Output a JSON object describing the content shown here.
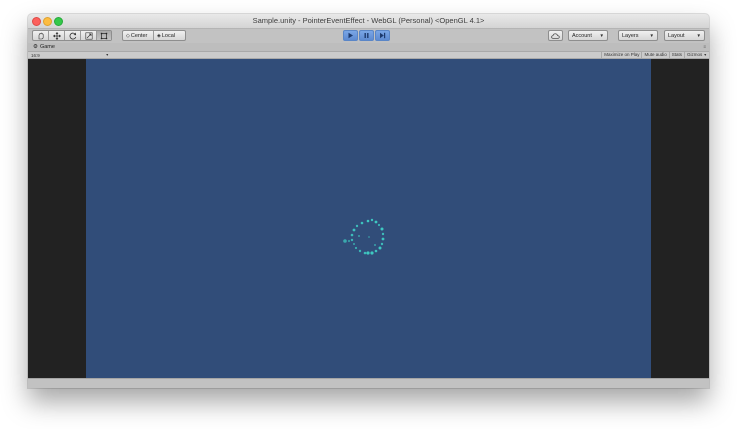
{
  "window": {
    "title": "Sample.unity - PointerEventEffect - WebGL (Personal) <OpenGL 4.1>"
  },
  "toolbar": {
    "tools": [
      {
        "icon": "hand-icon",
        "active": false
      },
      {
        "icon": "move-icon",
        "active": false
      },
      {
        "icon": "rotate-icon",
        "active": false
      },
      {
        "icon": "scale-icon",
        "active": false
      },
      {
        "icon": "rect-icon",
        "active": true
      }
    ],
    "pivot_label": "Center",
    "space_label": "Local",
    "play_icon": "play-icon",
    "pause_icon": "pause-icon",
    "step_icon": "step-icon",
    "cloud_icon": "cloud-icon",
    "account_label": "Account",
    "layers_label": "Layers",
    "layout_label": "Layout"
  },
  "game_tab": {
    "icon": "game-controller-icon",
    "label": "Game",
    "menu_label": "≡"
  },
  "game_toolbar": {
    "aspect_label": "16:9",
    "buttons": [
      "Maximize on Play",
      "Mute audio",
      "Stats",
      "Gizmos"
    ]
  },
  "colors": {
    "game_background": "#314d79",
    "letterbox": "#222222",
    "particle": "#3fd0c5",
    "play_button_active": "#5d8ad1"
  }
}
